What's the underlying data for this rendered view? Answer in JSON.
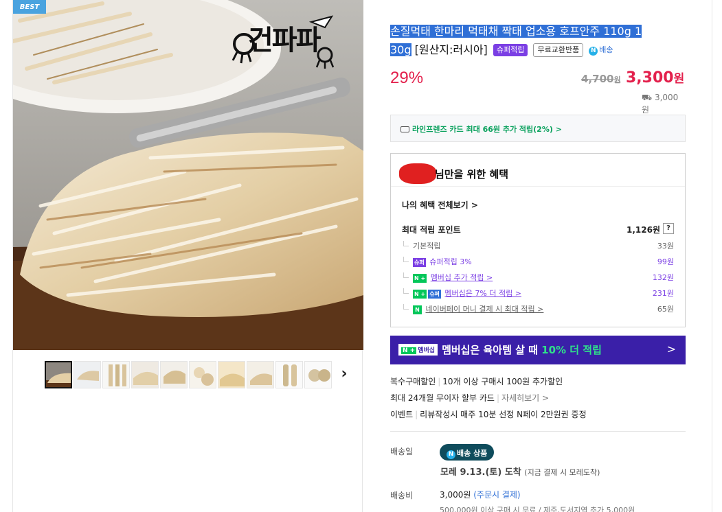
{
  "gallery": {
    "badge": "BEST",
    "brand_logo_text": "건파파",
    "thumbnail_count": 10,
    "active_thumbnail": 1
  },
  "product": {
    "title_part1": "손질먹태 한마리 먹태채 짝태 업소용 호프안주 110g 1",
    "title_part2": "30g",
    "title_part3": " [원산지:러시아]",
    "tags": {
      "super_points": "슈퍼적립",
      "free_exchange": "무료교환반품",
      "n_delivery": "배송"
    },
    "discount": "29%",
    "original_price": "4,700",
    "original_price_unit": "원",
    "sale_price": "3,300",
    "sale_price_unit": "원",
    "shipping_fee": "3,000원"
  },
  "card_promo": {
    "text": "라인프렌즈 카드 최대 66원 추가 적립(2%) >"
  },
  "benefits": {
    "heading": "님만을 위한 혜택",
    "view_all": "나의 혜택 전체보기 >",
    "max_points_label": "최대 적립 포인트",
    "max_points_value": "1,126원",
    "help": "?",
    "rows": [
      {
        "label": "기본적립",
        "value": "33원"
      },
      {
        "label": "슈퍼적립 3%",
        "value": "99원",
        "badge": "슈퍼"
      },
      {
        "label": "멤버십 추가 적립 >",
        "value": "132원",
        "badge": "N +"
      },
      {
        "label": "멤버십은 7% 더 적립 >",
        "value": "231원",
        "badge": "N +",
        "badge2": "슈퍼"
      },
      {
        "label": "네이버페이 머니 결제 시 최대 적립 >",
        "value": "65원",
        "badge": "N"
      }
    ]
  },
  "member_banner": {
    "badge_n": "N +",
    "badge_label": "멤버십",
    "text_prefix": "멤버십은 육아템 살 때 ",
    "text_highlight": "10% 더 적립",
    "arrow": ">"
  },
  "promos": {
    "multi_label": "복수구매할인",
    "multi_text": "10개 이상 구매시 100원 추가할인",
    "installment_text": "최대 24개월 무이자 할부 카드",
    "installment_link": "자세히보기 >",
    "event_label": "이벤트",
    "event_text": "리뷰작성시 매주 10분 선정 N페이 2만원권 증정"
  },
  "delivery": {
    "date_label": "배송일",
    "badge": "배송 상품",
    "arrival": "모레 9.13.(토) 도착",
    "arrival_note": "(지금 결제 시 모레도착)",
    "fee_label": "배송비",
    "fee": "3,000원",
    "fee_note": "(주문시 결제)",
    "extra": "500,000원 이상 구매 시 무료 / 제주,도서지역 추가 5,000원"
  },
  "colors": {
    "price_red": "#e3204c",
    "super_purple": "#7b3fe4",
    "naver_green": "#03c75a",
    "banner_purple": "#3a1fa8",
    "delivery_teal": "#0f4c5c"
  }
}
